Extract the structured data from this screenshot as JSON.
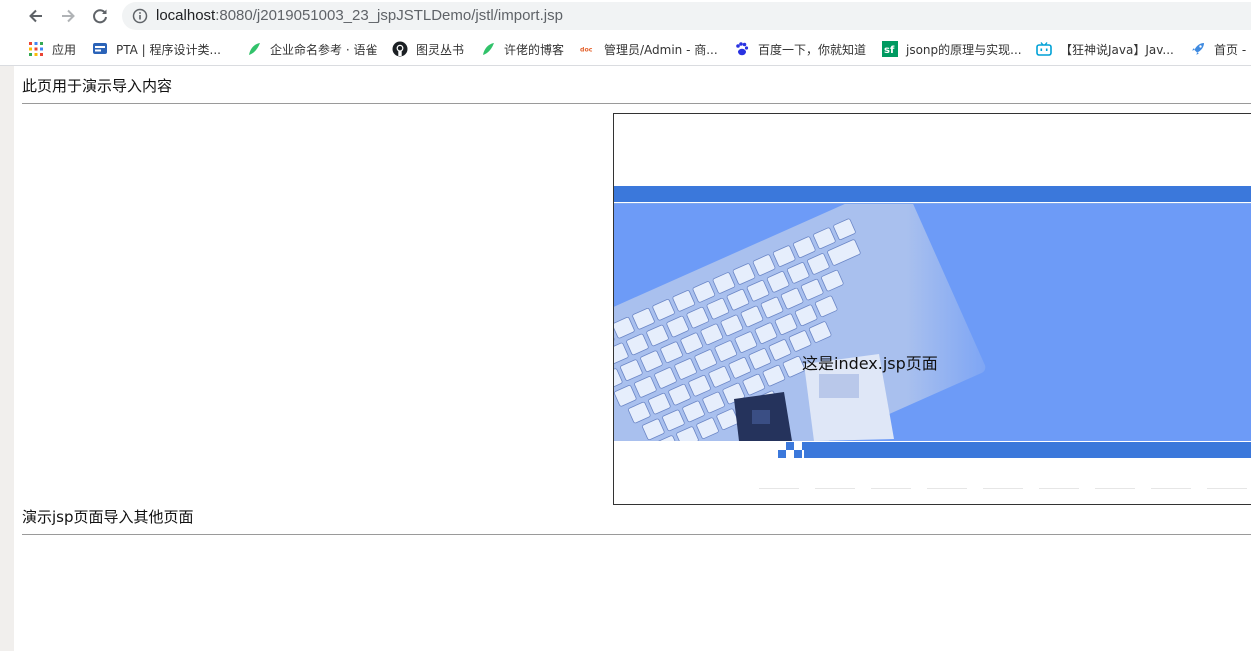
{
  "browser": {
    "url_host": "localhost",
    "url_rest": ":8080/j2019051003_23_jspJSTLDemo/jstl/import.jsp",
    "bookmarks": [
      {
        "label": "应用",
        "icon": "apps-grid-icon"
      },
      {
        "label": "PTA | 程序设计类...",
        "icon": "pta-icon"
      },
      {
        "label": "企业命名参考 · 语雀",
        "icon": "yuque-icon"
      },
      {
        "label": "图灵丛书",
        "icon": "github-icon"
      },
      {
        "label": "许佬的博客",
        "icon": "yuque-icon"
      },
      {
        "label": "管理员/Admin - 商...",
        "icon": "doc-icon"
      },
      {
        "label": "百度一下，你就知道",
        "icon": "baidu-paw-icon"
      },
      {
        "label": "jsonp的原理与实现...",
        "icon": "segmentfault-icon"
      },
      {
        "label": "【狂神说Java】Jav...",
        "icon": "bilibili-icon"
      },
      {
        "label": "首页 - ...",
        "icon": "rocket-icon"
      }
    ]
  },
  "page": {
    "heading": "此页用于演示导入内容",
    "frame_text": "这是index.jsp页面",
    "section_heading": "演示jsp页面导入其他页面"
  },
  "colors": {
    "banner_blue": "#6d9bf7",
    "bar_blue": "#3b78db"
  }
}
